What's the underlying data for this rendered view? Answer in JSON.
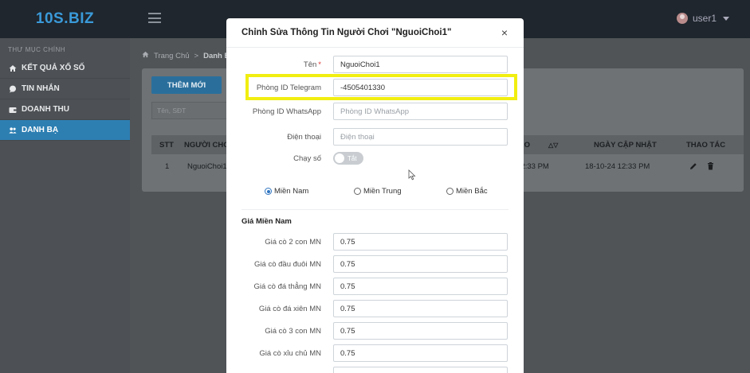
{
  "header": {
    "brand": "10S.BIZ",
    "user": "user1"
  },
  "sidebar": {
    "section": "THƯ MỤC CHÍNH",
    "items": [
      {
        "label": "KẾT QUẢ XỔ SỐ",
        "icon": "home-icon"
      },
      {
        "label": "TIN NHẮN",
        "icon": "message-icon"
      },
      {
        "label": "DOANH THU",
        "icon": "wallet-icon"
      },
      {
        "label": "DANH BẠ",
        "icon": "users-icon",
        "active": true
      }
    ]
  },
  "breadcrumb": {
    "home": "Trang Chủ",
    "current": "Danh Bạ"
  },
  "page": {
    "add_button": "THÊM MỚI",
    "search_placeholder": "Tên, SĐT",
    "table": {
      "headers": [
        "STT",
        "NGƯỜI CHƠI",
        "TẠO",
        "NGÀY CẬP NHẬT",
        "THAO TÁC"
      ],
      "rows": [
        {
          "stt": "1",
          "player": "NguoiChoi1",
          "created": "-12:33 PM",
          "updated": "18-10-24 12:33 PM"
        }
      ]
    }
  },
  "modal": {
    "title": "Chỉnh Sửa Thông Tin Người Chơi \"NguoiChoi1\"",
    "close": "×",
    "fields": {
      "name": {
        "label": "Tên",
        "value": "NguoiChoi1"
      },
      "telegram": {
        "label": "Phòng ID Telegram",
        "value": "-4505401330"
      },
      "whatsapp": {
        "label": "Phòng ID WhatsApp",
        "placeholder": "Phòng ID WhatsApp"
      },
      "phone": {
        "label": "Điện thoại",
        "placeholder": "Điện thoại"
      },
      "toggle": {
        "label": "Chạy số",
        "value": "Tắt"
      }
    },
    "regions": [
      "Miền Nam",
      "Miền Trung",
      "Miền Bắc"
    ],
    "selected_region": "Miền Nam",
    "price_section": "Giá Miền Nam",
    "prices": [
      {
        "label": "Giá cò 2 con MN",
        "value": "0.75"
      },
      {
        "label": "Giá cò đầu đuôi MN",
        "value": "0.75"
      },
      {
        "label": "Giá cò đá thẳng MN",
        "value": "0.75"
      },
      {
        "label": "Giá cò đá xiên MN",
        "value": "0.75"
      },
      {
        "label": "Giá cò 3 con MN",
        "value": "0.75"
      },
      {
        "label": "Giá cò xỉu chủ MN",
        "value": "0.75"
      }
    ],
    "highlight_color": "#f1ee11"
  }
}
